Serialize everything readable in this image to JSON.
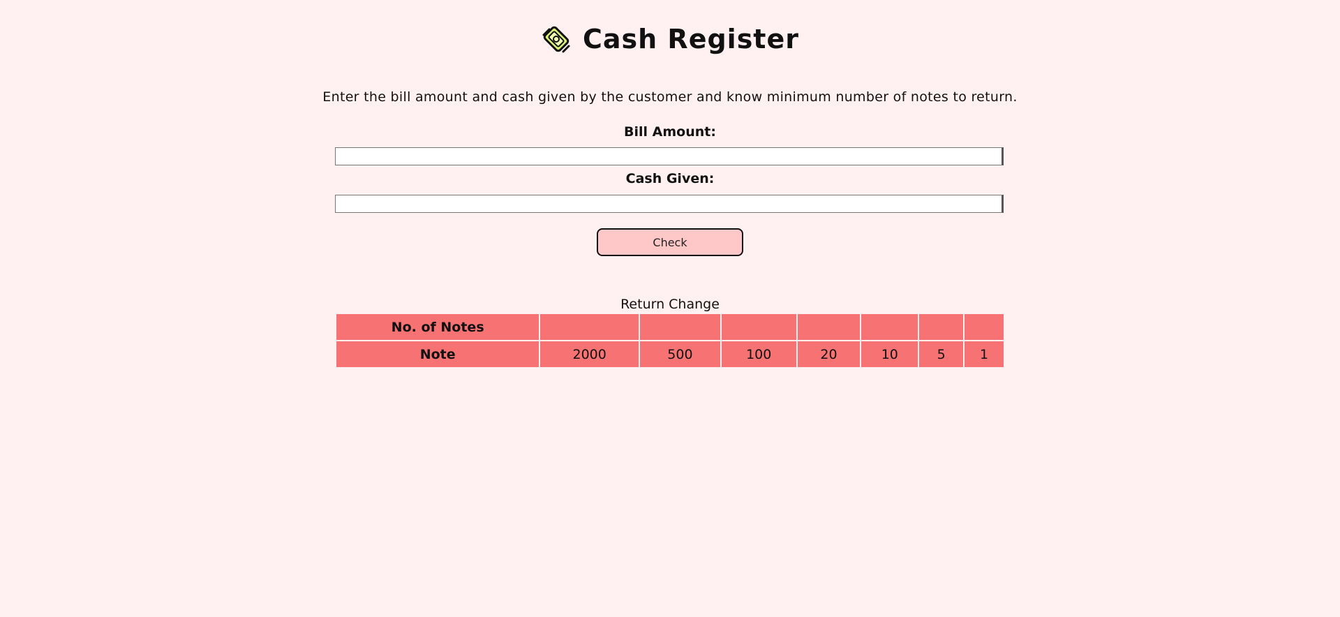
{
  "header": {
    "title": "Cash Register"
  },
  "description": "Enter the bill amount and cash given by the customer and know minimum number of notes to return.",
  "form": {
    "bill_label": "Bill Amount:",
    "bill_value": "",
    "cash_label": "Cash Given:",
    "cash_value": "",
    "check_label": "Check"
  },
  "table": {
    "caption": "Return Change",
    "row_notes_header": "No. of Notes",
    "row_note_header": "Note",
    "notes_counts": [
      "",
      "",
      "",
      "",
      "",
      "",
      ""
    ],
    "notes": [
      "2000",
      "500",
      "100",
      "20",
      "10",
      "5",
      "1"
    ]
  },
  "colors": {
    "background": "#fff1f1",
    "table_cell": "#f77272",
    "button_bg": "#ffc8c8"
  }
}
